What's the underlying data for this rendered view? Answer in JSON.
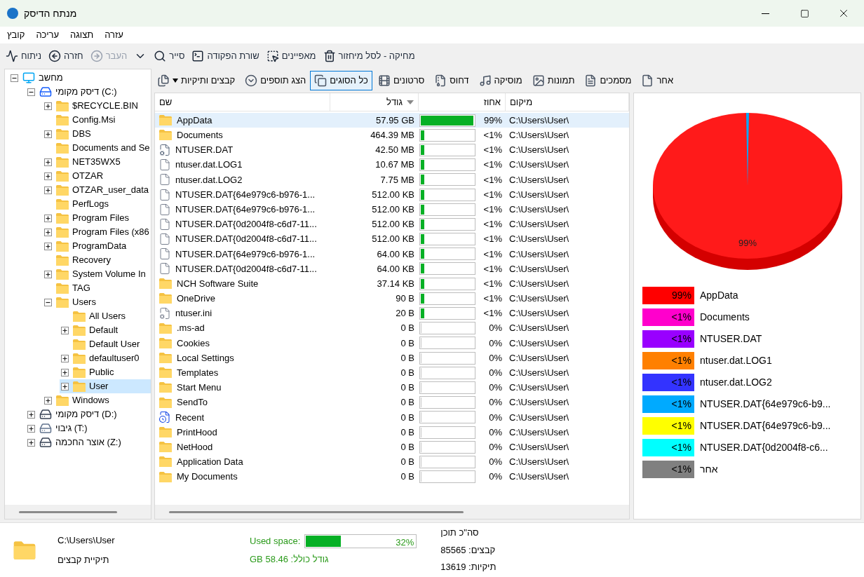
{
  "window": {
    "title": "מנתח הדיסק"
  },
  "menu": [
    {
      "label": "עזרה"
    },
    {
      "label": "תצוגה"
    },
    {
      "label": "עריכה"
    },
    {
      "label": "קובץ"
    }
  ],
  "toolbar": [
    {
      "kind": "delete",
      "label": "מחיקה - לסל מיחזור",
      "disabled": false
    },
    {
      "kind": "properties",
      "label": "מאפיינים",
      "disabled": false
    },
    {
      "kind": "terminal",
      "label": "שורת הפקודה",
      "disabled": false
    },
    {
      "kind": "explorer",
      "label": "סייר",
      "disabled": false
    },
    {
      "kind": "dropdown",
      "disabled": false
    },
    {
      "kind": "forward",
      "label": "העבר",
      "disabled": true
    },
    {
      "kind": "back",
      "label": "חזרה",
      "disabled": false
    },
    {
      "kind": "analyze",
      "label": "ניתוח",
      "disabled": false
    }
  ],
  "filters": [
    {
      "kind": "other",
      "label": "אחר",
      "selected": false
    },
    {
      "kind": "document",
      "label": "מסמכים",
      "selected": false
    },
    {
      "kind": "image",
      "label": "תמונות",
      "selected": false
    },
    {
      "kind": "music",
      "label": "מוסיקה",
      "selected": false
    },
    {
      "kind": "archive",
      "label": "דחוס",
      "selected": false
    },
    {
      "kind": "video",
      "label": "סרטונים",
      "selected": false
    },
    {
      "kind": "all",
      "label": "כל הסוגים",
      "selected": true
    }
  ],
  "show_extensions": {
    "label": "הצג תוספים"
  },
  "view_mode": {
    "label": "קבצים ותיקיות"
  },
  "tree": [
    {
      "kind": "computer",
      "label": "מחשב",
      "expanded": true,
      "selected": false,
      "children": [
        {
          "kind": "system-drive",
          "label": "דיסק מקומי (C:)",
          "expanded": true,
          "selected": false,
          "children": [
            {
              "kind": "folder",
              "label": "$RECYCLE.BIN",
              "expanded": false,
              "selected": false
            },
            {
              "kind": "folder",
              "label": "Config.Msi",
              "selected": false
            },
            {
              "kind": "folder",
              "label": "DBS",
              "expanded": false,
              "selected": false
            },
            {
              "kind": "folder",
              "label": "Documents and Se",
              "selected": false
            },
            {
              "kind": "folder",
              "label": "NET35WX5",
              "expanded": false,
              "selected": false
            },
            {
              "kind": "folder",
              "label": "OTZAR",
              "expanded": false,
              "selected": false
            },
            {
              "kind": "folder",
              "label": "OTZAR_user_data",
              "expanded": false,
              "selected": false
            },
            {
              "kind": "folder",
              "label": "PerfLogs",
              "selected": false
            },
            {
              "kind": "folder",
              "label": "Program Files",
              "expanded": false,
              "selected": false
            },
            {
              "kind": "folder",
              "label": "Program Files (x86",
              "expanded": false,
              "selected": false
            },
            {
              "kind": "folder",
              "label": "ProgramData",
              "expanded": false,
              "selected": false
            },
            {
              "kind": "folder",
              "label": "Recovery",
              "selected": false
            },
            {
              "kind": "folder",
              "label": "System Volume In",
              "expanded": false,
              "selected": false
            },
            {
              "kind": "folder",
              "label": "TAG",
              "selected": false
            },
            {
              "kind": "folder",
              "label": "Users",
              "expanded": true,
              "selected": false,
              "children": [
                {
                  "kind": "folder",
                  "label": "All Users",
                  "selected": false
                },
                {
                  "kind": "folder",
                  "label": "Default",
                  "expanded": false,
                  "selected": false
                },
                {
                  "kind": "folder",
                  "label": "Default User",
                  "selected": false
                },
                {
                  "kind": "folder",
                  "label": "defaultuser0",
                  "expanded": false,
                  "selected": false
                },
                {
                  "kind": "folder",
                  "label": "Public",
                  "expanded": false,
                  "selected": false
                },
                {
                  "kind": "folder",
                  "label": "User",
                  "expanded": false,
                  "selected": true
                }
              ]
            },
            {
              "kind": "folder",
              "label": "Windows",
              "expanded": false,
              "selected": false
            }
          ]
        },
        {
          "kind": "drive",
          "label": "דיסק מקומי (D:)",
          "expanded": false,
          "selected": false
        },
        {
          "kind": "network-drive",
          "label": "גיבוי (T:)",
          "expanded": false,
          "selected": false
        },
        {
          "kind": "drive",
          "label": "אוצר החכמה (Z:)",
          "expanded": false,
          "selected": false
        }
      ]
    }
  ],
  "table": {
    "columns": [
      {
        "label": "מיקום",
        "sorted": false
      },
      {
        "label": "אחוז",
        "sorted": false
      },
      {
        "label": "גודל",
        "sorted": true
      },
      {
        "label": "שם",
        "sorted": false
      }
    ],
    "rows": [
      {
        "kind": "folder",
        "name": "AppData",
        "size": "57.95 GB",
        "level": 0.99,
        "percent": "99%",
        "location": "C:\\Users\\User\\",
        "selected": true
      },
      {
        "kind": "folder",
        "name": "Documents",
        "size": "464.39 MB",
        "level": 0.01,
        "percent": "<1%",
        "location": "C:\\Users\\User\\",
        "selected": false
      },
      {
        "kind": "system-file",
        "name": "NTUSER.DAT",
        "size": "42.50 MB",
        "level": 0.01,
        "percent": "<1%",
        "location": "C:\\Users\\User\\",
        "selected": false
      },
      {
        "kind": "file",
        "name": "ntuser.dat.LOG1",
        "size": "10.67 MB",
        "level": 0.01,
        "percent": "<1%",
        "location": "C:\\Users\\User\\",
        "selected": false
      },
      {
        "kind": "file",
        "name": "ntuser.dat.LOG2",
        "size": "7.75 MB",
        "level": 0.01,
        "percent": "<1%",
        "location": "C:\\Users\\User\\",
        "selected": false
      },
      {
        "kind": "file",
        "name": "NTUSER.DAT{64e979c6-b976-1...",
        "size": "512.00 KB",
        "level": 0.01,
        "percent": "<1%",
        "location": "C:\\Users\\User\\",
        "selected": false
      },
      {
        "kind": "file",
        "name": "NTUSER.DAT{64e979c6-b976-1...",
        "size": "512.00 KB",
        "level": 0.01,
        "percent": "<1%",
        "location": "C:\\Users\\User\\",
        "selected": false
      },
      {
        "kind": "file",
        "name": "NTUSER.DAT{0d2004f8-c6d7-11...",
        "size": "512.00 KB",
        "level": 0.01,
        "percent": "<1%",
        "location": "C:\\Users\\User\\",
        "selected": false
      },
      {
        "kind": "file",
        "name": "NTUSER.DAT{0d2004f8-c6d7-11...",
        "size": "512.00 KB",
        "level": 0.01,
        "percent": "<1%",
        "location": "C:\\Users\\User\\",
        "selected": false
      },
      {
        "kind": "file",
        "name": "NTUSER.DAT{64e979c6-b976-1...",
        "size": "64.00 KB",
        "level": 0.01,
        "percent": "<1%",
        "location": "C:\\Users\\User\\",
        "selected": false
      },
      {
        "kind": "file",
        "name": "NTUSER.DAT{0d2004f8-c6d7-11...",
        "size": "64.00 KB",
        "level": 0.01,
        "percent": "<1%",
        "location": "C:\\Users\\User\\",
        "selected": false
      },
      {
        "kind": "folder",
        "name": "NCH Software Suite",
        "size": "37.14 KB",
        "level": 0.01,
        "percent": "<1%",
        "location": "C:\\Users\\User\\",
        "selected": false
      },
      {
        "kind": "folder",
        "name": "OneDrive",
        "size": "90 B",
        "level": 0.01,
        "percent": "<1%",
        "location": "C:\\Users\\User\\",
        "selected": false
      },
      {
        "kind": "config-file",
        "name": "ntuser.ini",
        "size": "20 B",
        "level": 0.01,
        "percent": "<1%",
        "location": "C:\\Users\\User\\",
        "selected": false
      },
      {
        "kind": "folder",
        "name": ".ms-ad",
        "size": "0 B",
        "level": 0,
        "percent": "0%",
        "location": "C:\\Users\\User\\",
        "selected": false
      },
      {
        "kind": "folder",
        "name": "Cookies",
        "size": "0 B",
        "level": 0,
        "percent": "0%",
        "location": "C:\\Users\\User\\",
        "selected": false
      },
      {
        "kind": "folder",
        "name": "Local Settings",
        "size": "0 B",
        "level": 0,
        "percent": "0%",
        "location": "C:\\Users\\User\\",
        "selected": false
      },
      {
        "kind": "folder",
        "name": "Templates",
        "size": "0 B",
        "level": 0,
        "percent": "0%",
        "location": "C:\\Users\\User\\",
        "selected": false
      },
      {
        "kind": "folder",
        "name": "Start Menu",
        "size": "0 B",
        "level": 0,
        "percent": "0%",
        "location": "C:\\Users\\User\\",
        "selected": false
      },
      {
        "kind": "folder",
        "name": "SendTo",
        "size": "0 B",
        "level": 0,
        "percent": "0%",
        "location": "C:\\Users\\User\\",
        "selected": false
      },
      {
        "kind": "shortcut",
        "name": "Recent",
        "size": "0 B",
        "level": 0,
        "percent": "0%",
        "location": "C:\\Users\\User\\",
        "selected": false
      },
      {
        "kind": "folder",
        "name": "PrintHood",
        "size": "0 B",
        "level": 0,
        "percent": "0%",
        "location": "C:\\Users\\User\\",
        "selected": false
      },
      {
        "kind": "folder",
        "name": "NetHood",
        "size": "0 B",
        "level": 0,
        "percent": "0%",
        "location": "C:\\Users\\User\\",
        "selected": false
      },
      {
        "kind": "folder",
        "name": "Application Data",
        "size": "0 B",
        "level": 0,
        "percent": "0%",
        "location": "C:\\Users\\User\\",
        "selected": false
      },
      {
        "kind": "folder",
        "name": "My Documents",
        "size": "0 B",
        "level": 0,
        "percent": "0%",
        "location": "C:\\Users\\User\\",
        "selected": false
      }
    ]
  },
  "pie": {
    "label": "99%"
  },
  "legend": [
    {
      "color": "#ff0000",
      "percent": "99%",
      "name": "AppData"
    },
    {
      "color": "#ff00cc",
      "percent": "<1%",
      "name": "Documents"
    },
    {
      "color": "#9900ff",
      "percent": "<1%",
      "name": "NTUSER.DAT"
    },
    {
      "color": "#ff8000",
      "percent": "<1%",
      "name": "ntuser.dat.LOG1"
    },
    {
      "color": "#3333ff",
      "percent": "<1%",
      "name": "ntuser.dat.LOG2"
    },
    {
      "color": "#00aaff",
      "percent": "<1%",
      "name": "NTUSER.DAT{64e979c6-b9..."
    },
    {
      "color": "#ffff00",
      "percent": "<1%",
      "name": "NTUSER.DAT{64e979c6-b9..."
    },
    {
      "color": "#00ffff",
      "percent": "<1%",
      "name": "NTUSER.DAT{0d2004f8-c6..."
    },
    {
      "color": "#808080",
      "percent": "<1%",
      "name": "אחר"
    }
  ],
  "status_bar": {
    "path": "C:\\Users\\User",
    "type": "תיקיית קבצים",
    "used_label": "Used space:",
    "used": {
      "level": 0.32,
      "reading": "32%"
    },
    "total_size": "גודל כולל: 58.46 GB",
    "content_title": "סה\"כ תוכן",
    "files": "קבצים: 85565",
    "folders": "תיקיות: 13619"
  }
}
